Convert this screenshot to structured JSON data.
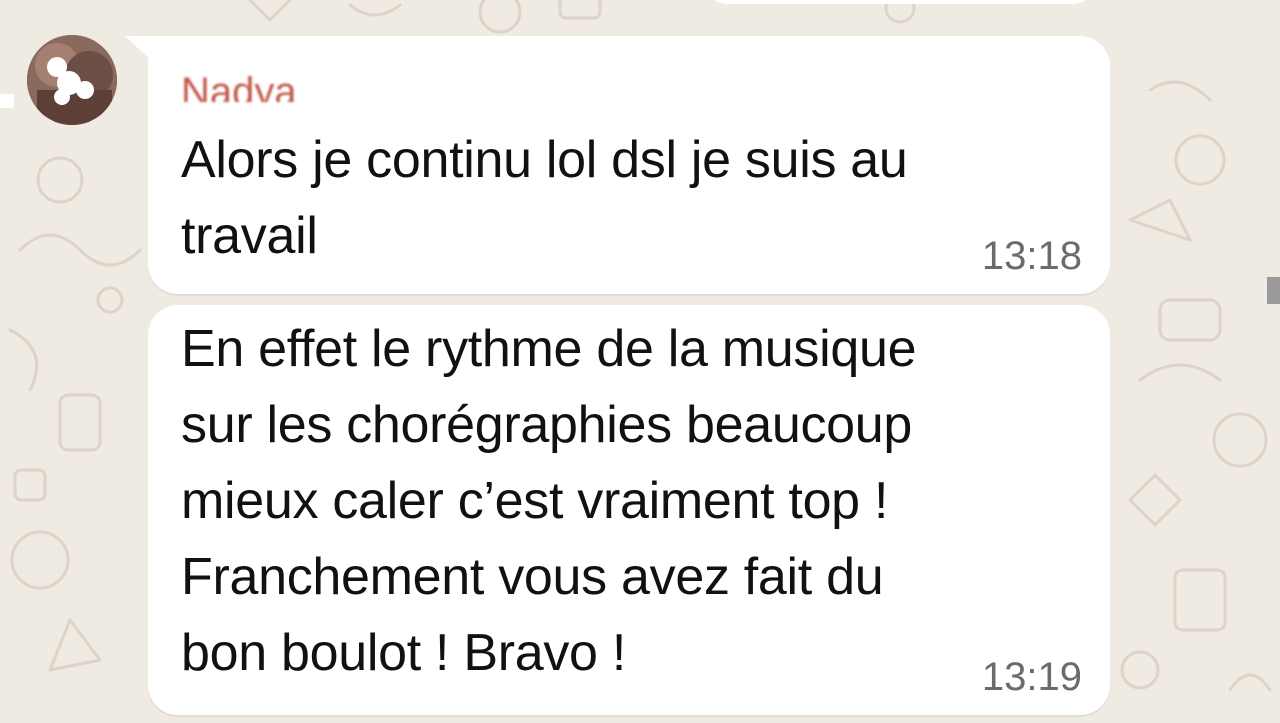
{
  "chat": {
    "messages": [
      {
        "sender": "Nadya",
        "text": "Alors je continu lol dsl je suis au\ntravail",
        "time": "13:18"
      },
      {
        "text": "En effet le rythme de la musique\nsur les chorégraphies beaucoup\nmieux caler c’est vraiment top !\nFranchement vous avez fait du\nbon boulot ! Bravo !",
        "time": "13:19"
      }
    ]
  },
  "colors": {
    "wallpaper": "#efeae2",
    "bubble": "#ffffff",
    "sender_name": "#c2574a",
    "timestamp": "#6b6b6b"
  },
  "icons": [
    "avatar"
  ]
}
